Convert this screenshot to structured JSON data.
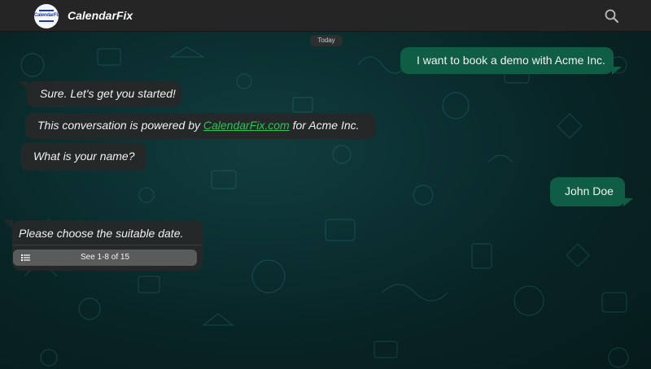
{
  "header": {
    "logo_text": "CalendarFix",
    "title": "CalendarFix",
    "search_icon": "search-icon"
  },
  "date_divider": "Today",
  "messages": [
    {
      "direction": "outgoing",
      "text": "I want to book a demo with Acme Inc."
    },
    {
      "direction": "incoming",
      "text": "Sure. Let's get you started!"
    },
    {
      "direction": "incoming",
      "prefix": "This conversation is powered by ",
      "link": "CalendarFix.com",
      "suffix": " for Acme Inc."
    },
    {
      "direction": "incoming",
      "text": "What is your name?"
    },
    {
      "direction": "outgoing",
      "text": "John Doe"
    },
    {
      "direction": "incoming",
      "text": "Please choose the suitable date.",
      "button_label": "See 1-8 of 15",
      "button_icon": "list-icon"
    }
  ],
  "colors": {
    "header_bg": "#252525",
    "incoming_bubble": "#252828",
    "outgoing_bubble": "#0f5d44",
    "link": "#29c45a",
    "chat_bg": "#0b2f30"
  }
}
